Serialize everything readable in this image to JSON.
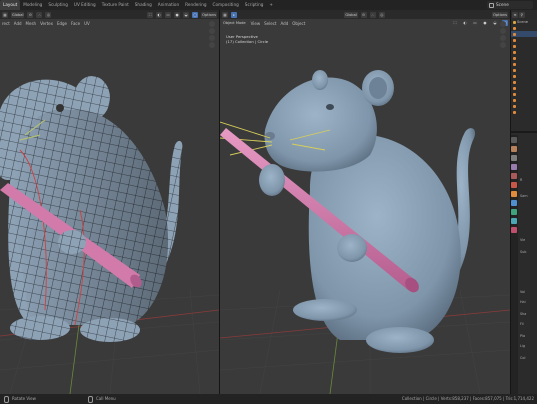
{
  "workspace_tabs": [
    "Layout",
    "Modeling",
    "Sculpting",
    "UV Editing",
    "Texture Paint",
    "Shading",
    "Animation",
    "Rendering",
    "Compositing",
    "Scripting",
    "+"
  ],
  "active_tab_index": 0,
  "scene": {
    "label": "Scene"
  },
  "left_viewport": {
    "transform_label": "Global",
    "options_label": "Options",
    "menu": [
      "rect",
      "Add",
      "Mesh",
      "Vertex",
      "Edge",
      "Face",
      "UV"
    ]
  },
  "right_viewport": {
    "mode_label": "Object Mode",
    "transform_label": "Global",
    "options_label": "Options",
    "menu": [
      "View",
      "Select",
      "Add",
      "Object"
    ],
    "overlay_line1": "User Perspective",
    "overlay_line2": "(17) Collection | Circle"
  },
  "outliner": {
    "rows": [
      "Scene",
      "",
      "",
      "",
      "",
      "",
      "",
      "",
      "",
      "",
      "",
      "",
      "",
      "",
      "",
      ""
    ]
  },
  "properties": {
    "labels": [
      "R",
      "Sam",
      "Vie",
      "Sub",
      "Vol",
      "Hai",
      "Sha",
      "Fil",
      "Pla",
      "Lig",
      "Col"
    ]
  },
  "status": {
    "left_action": "Rotate View",
    "mid_action": "Call Menu",
    "right_text": "Collection | Circle | Verts:858,237 | Faces:857,075 | Tris:1,714,422"
  },
  "colors": {
    "accent": "#4772b3",
    "viewport_bg": "#3a3a3a",
    "mesh": "#8aa0b4",
    "rod": "#d27aa9"
  }
}
